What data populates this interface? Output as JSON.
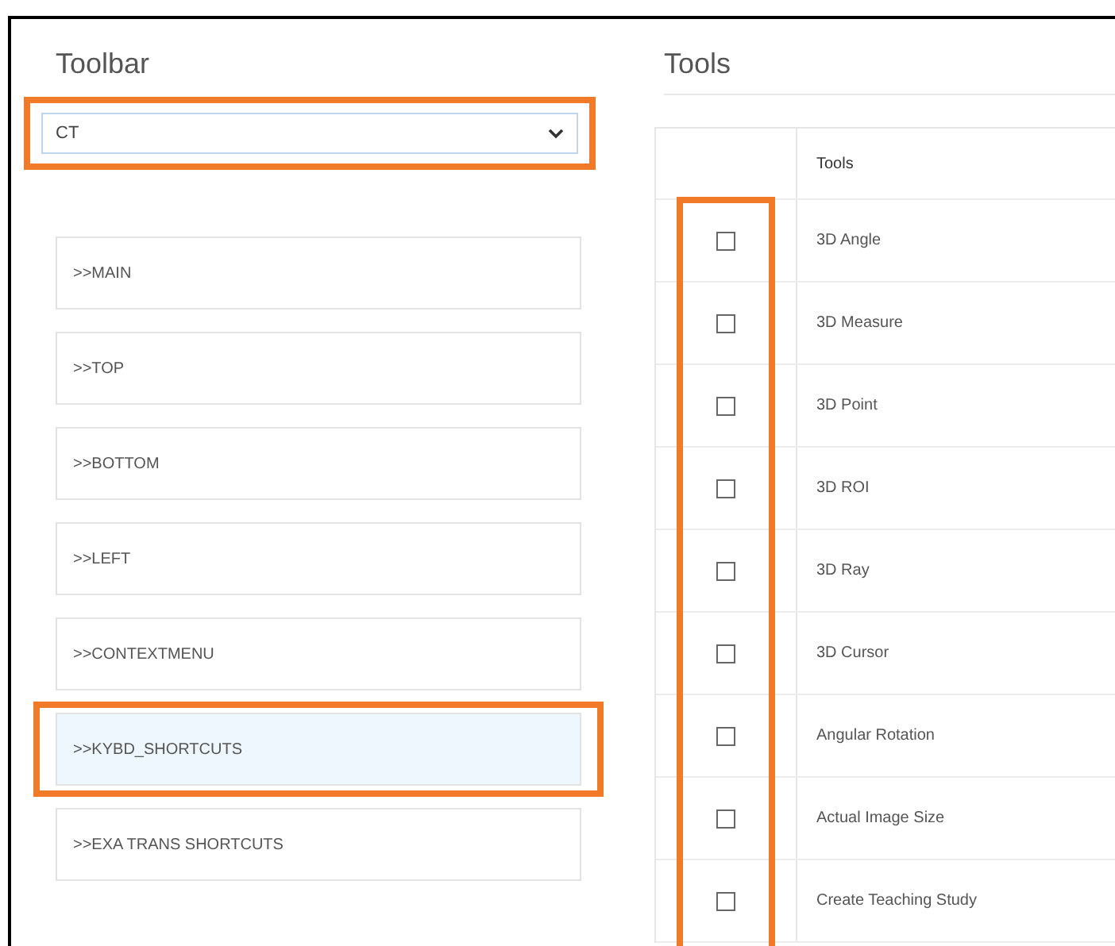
{
  "toolbar": {
    "title": "Toolbar",
    "dropdown": {
      "value": "CT",
      "highlighted": true
    },
    "items": [
      {
        "label": ">>MAIN",
        "selected": false,
        "highlighted": false
      },
      {
        "label": ">>TOP",
        "selected": false,
        "highlighted": false
      },
      {
        "label": ">>BOTTOM",
        "selected": false,
        "highlighted": false
      },
      {
        "label": ">>LEFT",
        "selected": false,
        "highlighted": false
      },
      {
        "label": ">>CONTEXTMENU",
        "selected": false,
        "highlighted": false
      },
      {
        "label": ">>KYBD_SHORTCUTS",
        "selected": true,
        "highlighted": true
      },
      {
        "label": ">>EXA TRANS SHORTCUTS",
        "selected": false,
        "highlighted": false
      }
    ]
  },
  "tools": {
    "title": "Tools",
    "checkbox_column_highlighted": true,
    "table": {
      "columns": [
        "Tools"
      ],
      "rows": [
        {
          "name": "3D Angle",
          "checked": false
        },
        {
          "name": "3D Measure",
          "checked": false
        },
        {
          "name": "3D Point",
          "checked": false
        },
        {
          "name": "3D ROI",
          "checked": false
        },
        {
          "name": "3D Ray",
          "checked": false
        },
        {
          "name": "3D Cursor",
          "checked": false
        },
        {
          "name": "Angular Rotation",
          "checked": false
        },
        {
          "name": "Actual Image Size",
          "checked": false
        },
        {
          "name": "Create Teaching Study",
          "checked": false
        }
      ]
    }
  }
}
